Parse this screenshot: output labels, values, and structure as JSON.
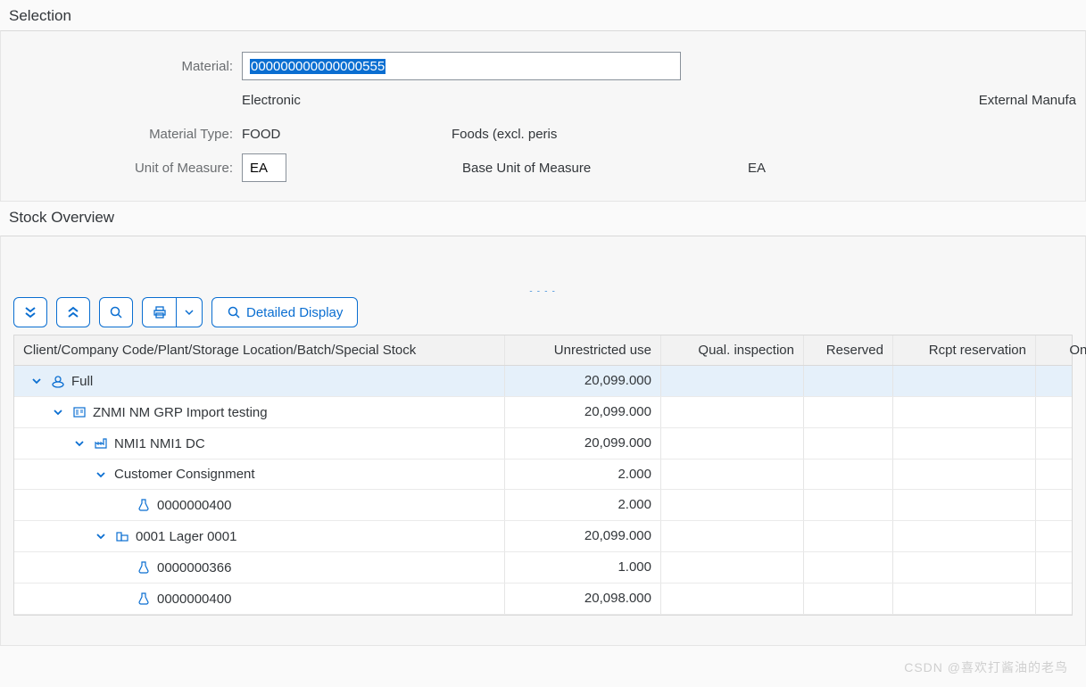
{
  "selection": {
    "title": "Selection",
    "materialLabel": "Material:",
    "materialValue": "000000000000000555",
    "materialDesc": "Electronic",
    "externalLabel": "External Manufa",
    "materialTypeLabel": "Material Type:",
    "materialTypeValue": "FOOD",
    "materialTypeDesc": "Foods (excl. peris",
    "uomLabel": "Unit of Measure:",
    "uomValue": "EA",
    "baseUomLabel": "Base Unit of Measure",
    "baseUomValue": "EA"
  },
  "overview": {
    "title": "Stock Overview",
    "detailedDisplay": "Detailed Display",
    "cols": {
      "hier": "Client/Company Code/Plant/Storage Location/Batch/Special Stock",
      "unrestricted": "Unrestricted use",
      "qual": "Qual. inspection",
      "reserved": "Reserved",
      "rcpt": "Rcpt reservation",
      "onorder": "On-Or"
    },
    "rows": [
      {
        "indent": 0,
        "exp": true,
        "iconKey": "full",
        "label": "Full",
        "unrestricted": "20,099.000",
        "selected": true
      },
      {
        "indent": 1,
        "exp": true,
        "iconKey": "company",
        "label": "ZNMI NM GRP Import testing",
        "unrestricted": "20,099.000"
      },
      {
        "indent": 2,
        "exp": true,
        "iconKey": "plant",
        "label": "NMI1 NMI1 DC",
        "unrestricted": "20,099.000"
      },
      {
        "indent": 3,
        "exp": true,
        "iconKey": "none",
        "label": "Customer Consignment",
        "unrestricted": "2.000"
      },
      {
        "indent": 4,
        "exp": false,
        "iconKey": "batch",
        "label": "0000000400",
        "unrestricted": "2.000"
      },
      {
        "indent": 3,
        "exp": true,
        "iconKey": "sloc",
        "label": "0001 Lager 0001",
        "unrestricted": "20,099.000"
      },
      {
        "indent": 4,
        "exp": false,
        "iconKey": "batch",
        "label": "0000000366",
        "unrestricted": "1.000"
      },
      {
        "indent": 4,
        "exp": false,
        "iconKey": "batch",
        "label": "0000000400",
        "unrestricted": "20,098.000"
      }
    ]
  },
  "watermark": "CSDN @喜欢打酱油的老鸟"
}
